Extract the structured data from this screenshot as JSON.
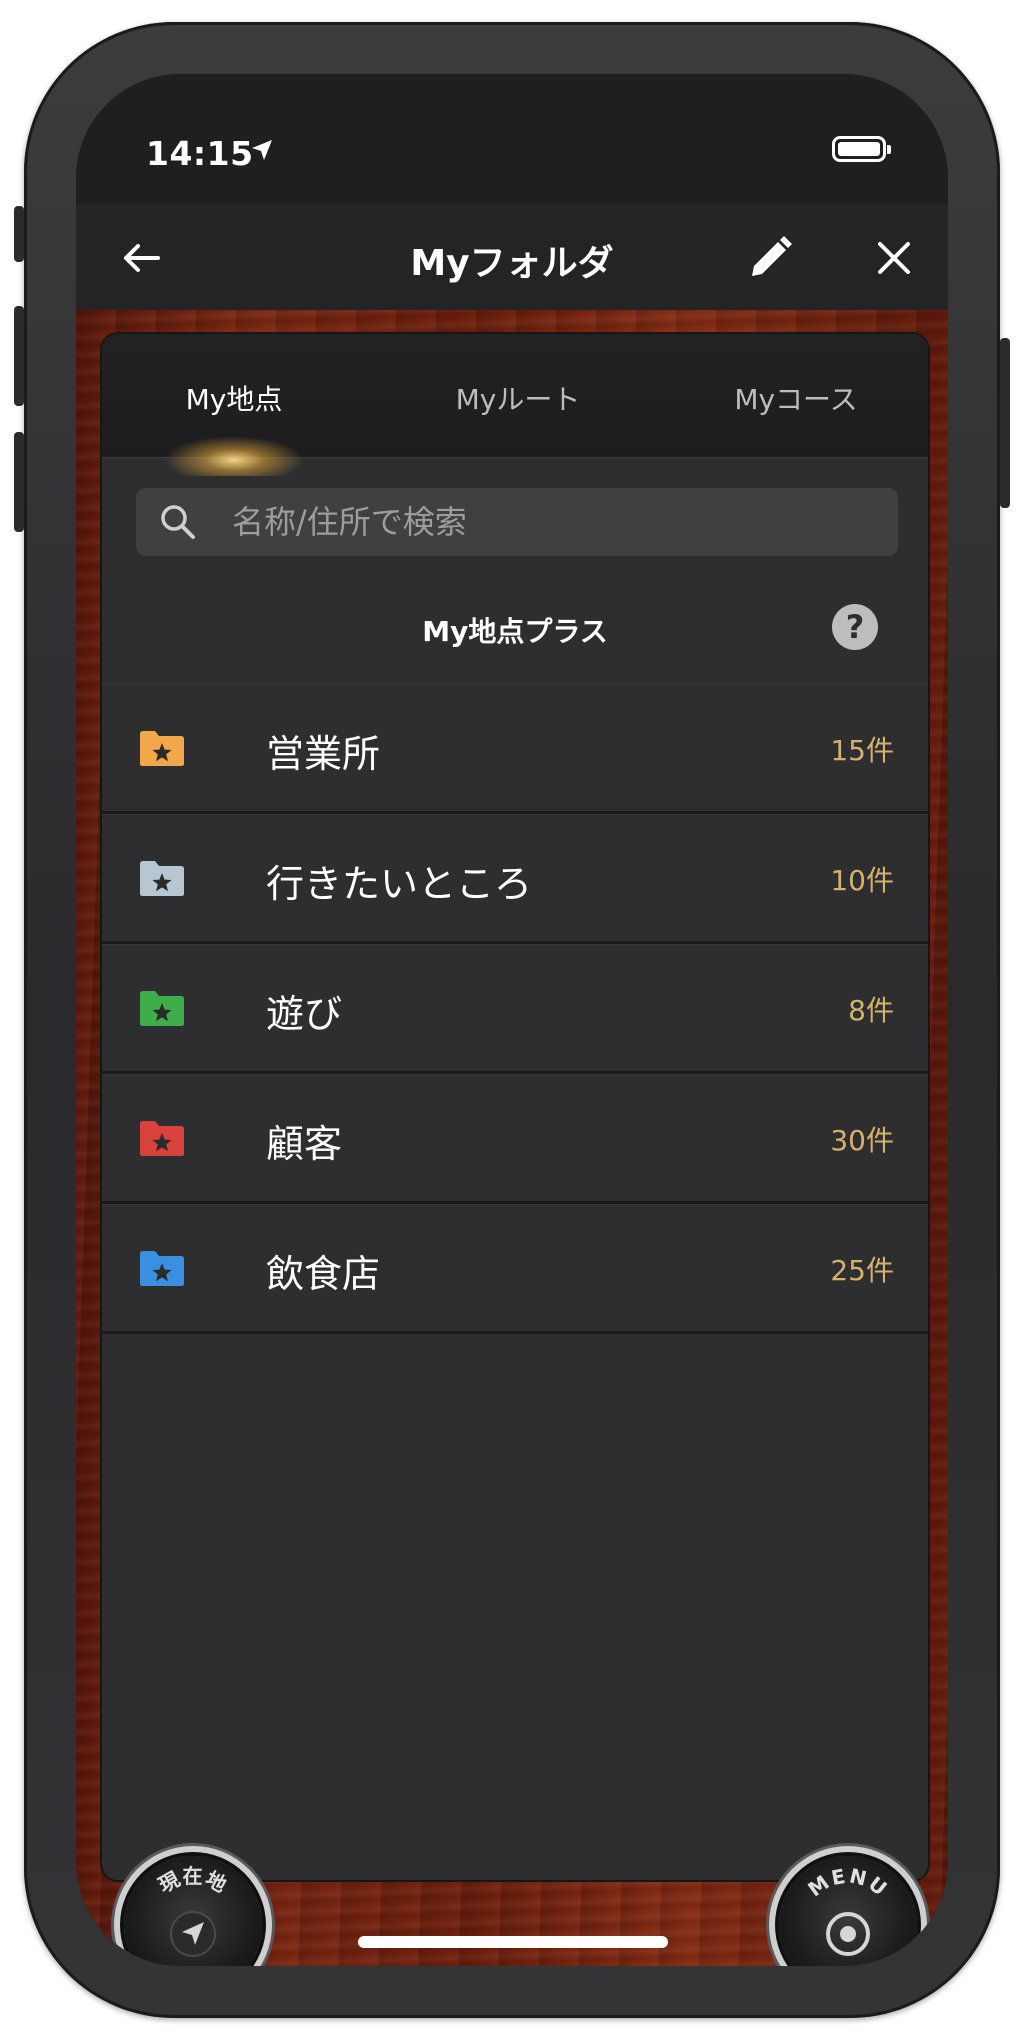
{
  "status_bar": {
    "time": "14:15"
  },
  "nav": {
    "title": "Myフォルダ",
    "back_icon": "arrow-left-icon",
    "edit_icon": "pencil-icon",
    "close_icon": "close-icon"
  },
  "tabs": [
    {
      "label": "My地点",
      "active": true
    },
    {
      "label": "Myルート",
      "active": false
    },
    {
      "label": "Myコース",
      "active": false
    }
  ],
  "search": {
    "placeholder": "名称/住所で検索",
    "value": ""
  },
  "section": {
    "title": "My地点プラス",
    "help_icon": "?"
  },
  "folders": [
    {
      "label": "営業所",
      "count": "15件",
      "color": "#f2a74a"
    },
    {
      "label": "行きたいところ",
      "count": "10件",
      "color": "#b7c6d0"
    },
    {
      "label": "遊び",
      "count": "8件",
      "color": "#3fae4a"
    },
    {
      "label": "顧客",
      "count": "30件",
      "color": "#d8423c"
    },
    {
      "label": "飲食店",
      "count": "25件",
      "color": "#3b8fe0"
    }
  ],
  "buttons": {
    "current_location": "現在地",
    "menu": "MENU"
  },
  "colors": {
    "accent_count": "#d6b16a",
    "panel": "#2e2e30",
    "wood": "#7a2612"
  }
}
